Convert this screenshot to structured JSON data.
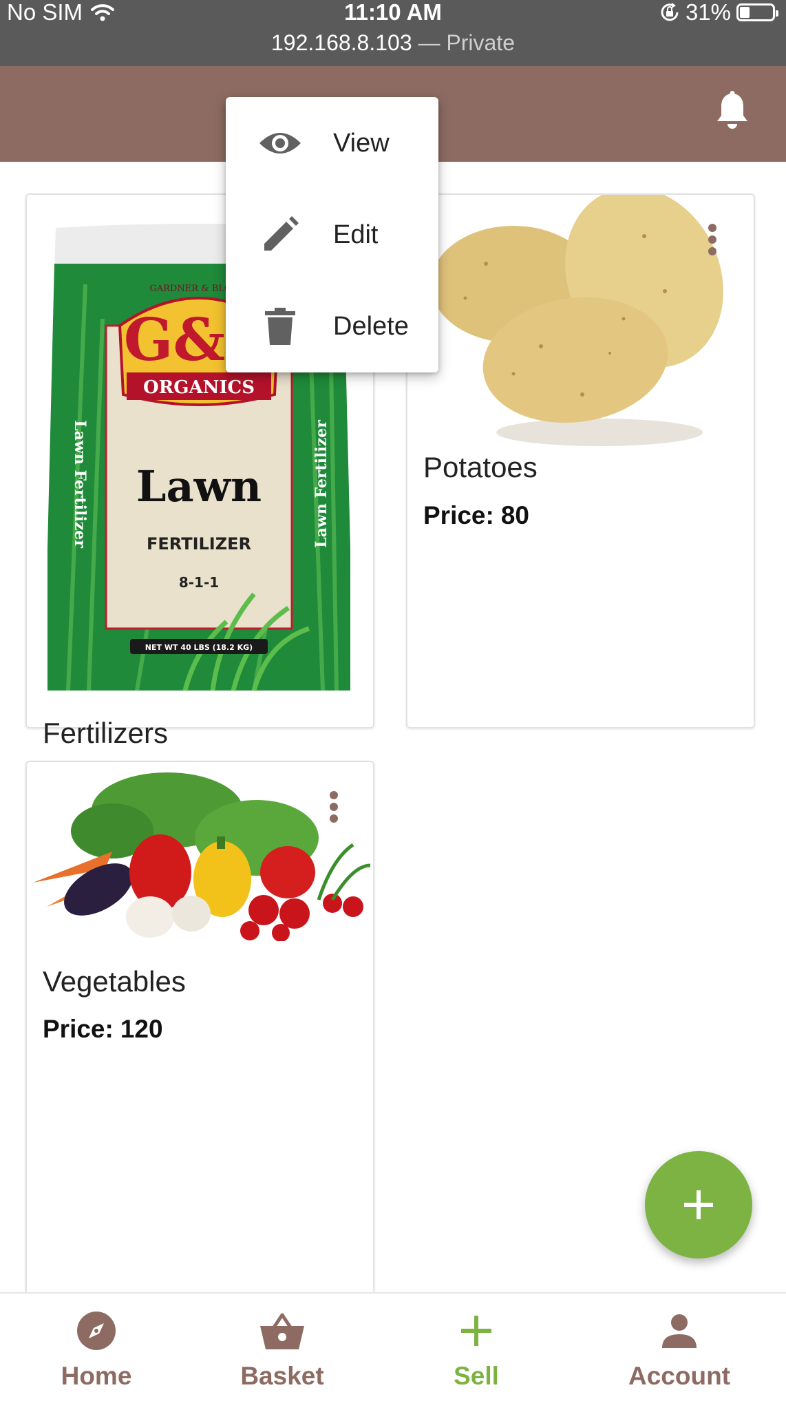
{
  "status_bar": {
    "carrier": "No SIM",
    "time": "11:10 AM",
    "battery": "31%",
    "battery_level": 0.31,
    "url": "192.168.8.103",
    "url_separator": "—",
    "url_mode": "Private"
  },
  "header": {
    "bell_icon": "bell-icon"
  },
  "popup_menu": {
    "items": [
      {
        "label": "View",
        "icon": "eye-icon"
      },
      {
        "label": "Edit",
        "icon": "pencil-icon"
      },
      {
        "label": "Delete",
        "icon": "trash-icon"
      }
    ]
  },
  "products": [
    {
      "title": "Fertilizers",
      "price_label": "",
      "price": "",
      "image": "G&D Organics Lawn Fertilizer bag",
      "image_text": [
        "GARDNER & BLOOM",
        "G&B",
        "ORGANICS",
        "Lawn",
        "FERTILIZER",
        "8-1-1",
        "Lawn Fertilizer",
        "NET WT 40 LBS (18.2 KG)"
      ]
    },
    {
      "title": "Potatoes",
      "price_label": "Price:",
      "price": "80",
      "image": "potatoes"
    },
    {
      "title": "Vegetables",
      "price_label": "Price:",
      "price": "120",
      "image": "mixed vegetables"
    }
  ],
  "fab": {
    "icon": "plus-icon"
  },
  "bottom_nav": [
    {
      "label": "Home",
      "icon": "compass-icon",
      "active": false
    },
    {
      "label": "Basket",
      "icon": "basket-icon",
      "active": false
    },
    {
      "label": "Sell",
      "icon": "plus-icon",
      "active": true
    },
    {
      "label": "Account",
      "icon": "person-icon",
      "active": false
    }
  ],
  "colors": {
    "header": "#8d6b62",
    "accent_green": "#7cb342",
    "nav_brown": "#8d6b62",
    "status_bar": "#5a5a5a"
  }
}
